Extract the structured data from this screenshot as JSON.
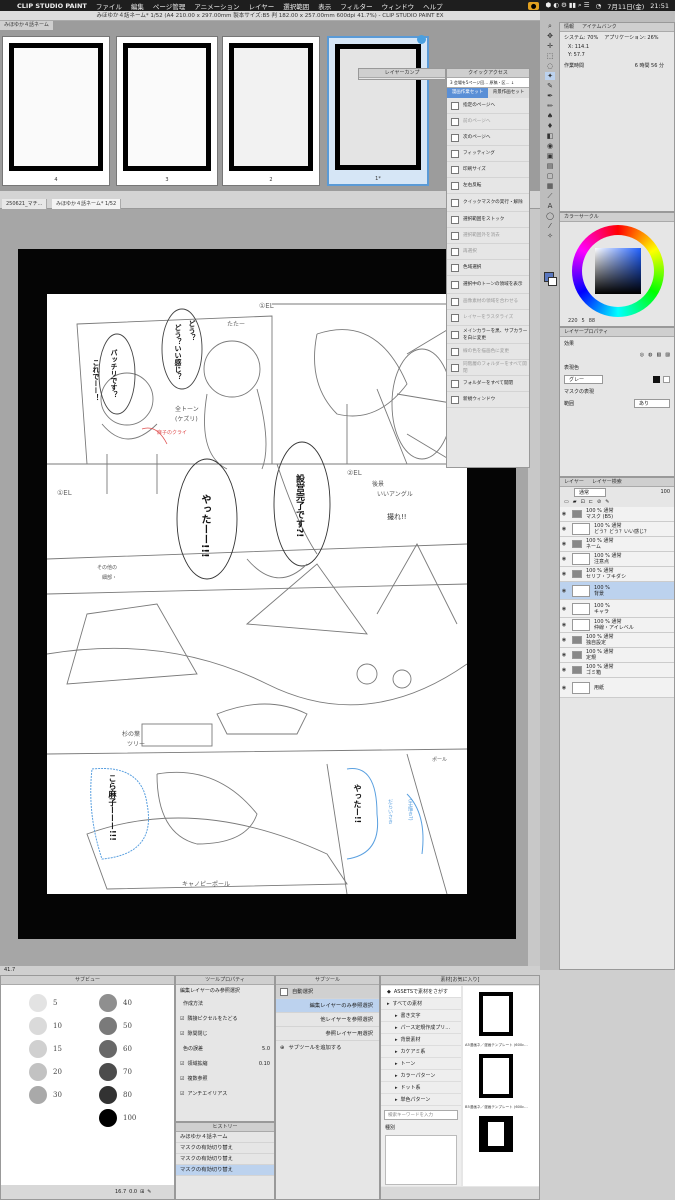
{
  "menubar": {
    "app": "CLIP STUDIO PAINT",
    "items": [
      "ファイル",
      "編集",
      "ページ管理",
      "アニメーション",
      "レイヤー",
      "選択範囲",
      "表示",
      "フィルター",
      "ウィンドウ",
      "ヘルプ"
    ],
    "date": "7月11日(金)",
    "time": "21:51"
  },
  "window": {
    "title": "みほゆか４話ネーム* 1/52 (A4 210.00 x 297.00mm 製本サイズ:B5 判 182.00 x 257.00mm 600dpi 41.7%) - CLIP STUDIO PAINT EX"
  },
  "page_strip": {
    "tab": "みほゆか４話ネーム",
    "pages": [
      {
        "label": "4"
      },
      {
        "label": "3"
      },
      {
        "label": "2"
      },
      {
        "label": "1*"
      }
    ]
  },
  "doc_tabs": [
    "250621_マチ...",
    "みほゆか４話ネーム* 1/52"
  ],
  "canvas_texts": {
    "b1": "パッチリです？",
    "b2": "これでーー！",
    "b3": "どう？いい感じ？",
    "b4": "どう？",
    "b5": "やったーー!!!",
    "b6": "設営完了です?!",
    "b7": "こら麻子ーーー!!!",
    "b8": "やったー!!",
    "s1": "たたー",
    "s2": "全トーン",
    "s3": "(ケズリ)",
    "s4": "①EL",
    "s5": "①EL",
    "s6": "麻子のクライ",
    "s7": "②EL",
    "s8": "後景",
    "s9": "いいアングル",
    "s10": "撮れ!!",
    "s11": "その他の",
    "s12": "細部・",
    "s13": "杉の葉",
    "s14": "ツリー",
    "s15": "ポール",
    "s16": "キャノピーポール",
    "s17": "(手描き?)",
    "s18": "だらいさき"
  },
  "layer_comp": {
    "title": "レイヤーカンプ"
  },
  "quick_access": {
    "title": "クイックアクセス",
    "dropdown": "3 会場を5ページ回… 原稿・区… ↓",
    "tabs": [
      "漫画作業セット",
      "背景作画セット"
    ],
    "items": [
      {
        "label": "指定のページへ",
        "enabled": true
      },
      {
        "label": "前のページへ",
        "enabled": false
      },
      {
        "label": "次のページへ",
        "enabled": true
      },
      {
        "label": "フィッティング",
        "enabled": true
      },
      {
        "label": "印刷サイズ",
        "enabled": true
      },
      {
        "label": "左右反転",
        "enabled": true
      },
      {
        "label": "クイックマスクの実行・解除",
        "enabled": true
      },
      {
        "label": "選択範囲をストック",
        "enabled": true
      },
      {
        "label": "選択範囲外を消去",
        "enabled": false
      },
      {
        "label": "再選択",
        "enabled": false
      },
      {
        "label": "色域選択",
        "enabled": true
      },
      {
        "label": "選択中のトーンの領域を表示",
        "enabled": true
      },
      {
        "label": "画像素材の領域を合わせる",
        "enabled": false
      },
      {
        "label": "レイヤーをラスタライズ",
        "enabled": false
      },
      {
        "label": "メインカラーを黒、サブカラーを白に変更",
        "enabled": true
      },
      {
        "label": "線の色を描画色に変更",
        "enabled": false
      },
      {
        "label": "同階層のフォルダーをすべて開閉",
        "enabled": false
      },
      {
        "label": "フォルダーをすべて開閉",
        "enabled": true
      },
      {
        "label": "新規ウィンドウ",
        "enabled": true
      }
    ]
  },
  "info_panel": {
    "tabs": [
      "情報",
      "アイテムバンク"
    ],
    "system": "システム: 70%",
    "app_usage": "アプリケーション: 26%",
    "x": "X: 114.1",
    "y": "Y: 57.7",
    "work_time_label": "作業時間",
    "work_time": "6 時間 56 分"
  },
  "color_circle": {
    "title": "カラーサークル",
    "h": "220",
    "s": "5",
    "v": "88",
    "main_color": "#5a78c0"
  },
  "layer_property": {
    "title": "レイヤープロパティ",
    "effect": "効果",
    "expression_color": "表現色",
    "color_value": "グレー",
    "mask_label": "マスクの表現",
    "display": "範囲",
    "display_value": "あり"
  },
  "layer_panel": {
    "tabs": [
      "レイヤー",
      "レイヤー検索"
    ],
    "blend": "通常",
    "opacity": "100",
    "layers": [
      {
        "name": "100 % 通常\nマスク (B5)",
        "type": "folder",
        "sel": false
      },
      {
        "name": "100 % 通常\nどう？どう？いい感じ？",
        "type": "layer",
        "sel": false
      },
      {
        "name": "100 % 通常\nネーム",
        "type": "folder",
        "sel": false
      },
      {
        "name": "100 % 通常\n注意点",
        "type": "layer",
        "sel": false
      },
      {
        "name": "100 % 通常\nセリフ・フキダシ",
        "type": "folder",
        "sel": false
      },
      {
        "name": "100 %\n背景",
        "type": "layer",
        "sel": true
      },
      {
        "name": "100 %\nキャラ",
        "type": "layer",
        "sel": false
      },
      {
        "name": "100 % 通常\n仲線・アイレベル",
        "type": "layer",
        "sel": false
      },
      {
        "name": "100 % 通常\n独自設定",
        "type": "folder",
        "sel": false
      },
      {
        "name": "100 % 通常\n定規",
        "type": "folder",
        "sel": false
      },
      {
        "name": "100 % 通常\nゴミ箱",
        "type": "folder",
        "sel": false
      },
      {
        "name": "用紙",
        "type": "paper",
        "sel": false
      }
    ]
  },
  "sub_view": {
    "title": "サブビュー",
    "swatches": [
      {
        "left": "5",
        "right": "40",
        "lc": "#e3e3e3",
        "rc": "#8f8f8f"
      },
      {
        "left": "10",
        "right": "50",
        "lc": "#dadada",
        "rc": "#7a7a7a"
      },
      {
        "left": "15",
        "right": "60",
        "lc": "#d0d0d0",
        "rc": "#686868"
      },
      {
        "left": "20",
        "right": "70",
        "lc": "#c2c2c2",
        "rc": "#4c4c4c"
      },
      {
        "left": "30",
        "right": "80",
        "lc": "#a9a9a9",
        "rc": "#323232"
      },
      {
        "left": "",
        "right": "100",
        "lc": "#ffffff",
        "rc": "#000000"
      }
    ],
    "zoom": "16.7",
    "angle": "0.0"
  },
  "tool_property": {
    "title": "ツールプロパティ",
    "subtitle": "編集レイヤーのみ参照選択",
    "rows": [
      {
        "label": "作成方法",
        "value": ""
      },
      {
        "label": "隣接ピクセルをたどる",
        "value": ""
      },
      {
        "label": "隙間閉じ",
        "value": ""
      },
      {
        "label": "色の誤差",
        "value": "5.0"
      },
      {
        "label": "領域拡縮",
        "value": "0.10"
      },
      {
        "label": "複数参照",
        "value": ""
      },
      {
        "label": "アンチエイリアス",
        "value": ""
      }
    ]
  },
  "history": {
    "title": "ヒストリー",
    "items": [
      "みほゆか４話ネーム",
      "マスクの有効切り替え",
      "マスクの有効切り替え",
      "マスクの有効切り替え"
    ]
  },
  "sub_tool": {
    "title": "サブツール",
    "group": "自動選択",
    "items": [
      "編集レイヤーのみ参照選択",
      "他レイヤーを参照選択",
      "参照レイヤー用選択"
    ],
    "add": "サブツールを追加する"
  },
  "material": {
    "title": "素材[お気に入り]",
    "assets": "ASSETSで素材をさがす",
    "tree": [
      "すべての素材",
      "書き文字",
      "パース定規作成プリ…",
      "背景素材",
      "カケアミ系",
      "トーン",
      "カラーパターン",
      "ドット系",
      "単色パターン"
    ],
    "search_placeholder": "検索キーワードを入力",
    "tag": "種別",
    "thumbs": [
      "A5漫画ネ／漫画テンプレート (600c…",
      "B5漫画ネ／漫画テンプレート (600c…",
      ""
    ]
  },
  "statusbar": {
    "zoom": "41.7"
  }
}
